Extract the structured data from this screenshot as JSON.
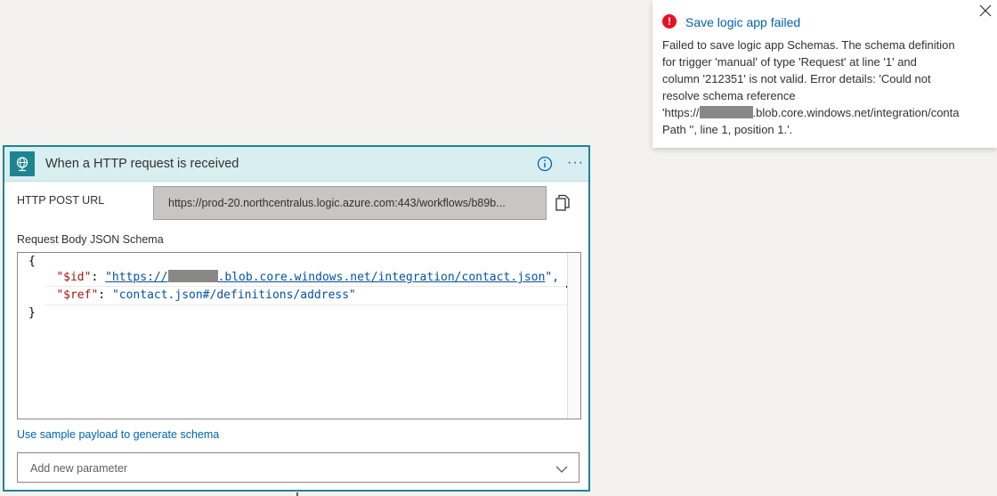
{
  "trigger": {
    "title": "When a HTTP request is received",
    "more_label": "···",
    "url_label": "HTTP POST URL",
    "url_value": "https://prod-20.northcentralus.logic.azure.com:443/workflows/b89b...",
    "schema_label": "Request Body JSON Schema",
    "schema_lines": {
      "open": "{",
      "id_key": "\"$id\"",
      "id_url_prefix": "\"https://",
      "id_url_suffix": ".blob.core.windows.net/integration/contact.json",
      "id_end": "\",",
      "ref_key": "\"$ref\"",
      "ref_value": "\"contact.json#/definitions/address\"",
      "close": "}"
    },
    "sample_link": "Use sample payload to generate schema",
    "add_param_placeholder": "Add new parameter"
  },
  "toast": {
    "title": "Save logic app failed",
    "lines": [
      "Failed to save logic app Schemas. The schema definition",
      "for trigger 'manual' of type 'Request' at line '1' and",
      "column '212351' is not valid. Error details: 'Could not",
      "resolve schema reference"
    ],
    "url_line_prefix": "'https://",
    "url_line_suffix": ".blob.core.windows.net/integration/conta",
    "last_line": "Path '', line 1, position 1.'."
  },
  "colors": {
    "accent": "#1f8491",
    "link": "#0063b1",
    "error": "#e81123"
  },
  "icons": [
    "globe-icon",
    "info-icon",
    "more-icon",
    "copy-icon",
    "chevron-down-icon",
    "error-icon",
    "close-icon"
  ]
}
